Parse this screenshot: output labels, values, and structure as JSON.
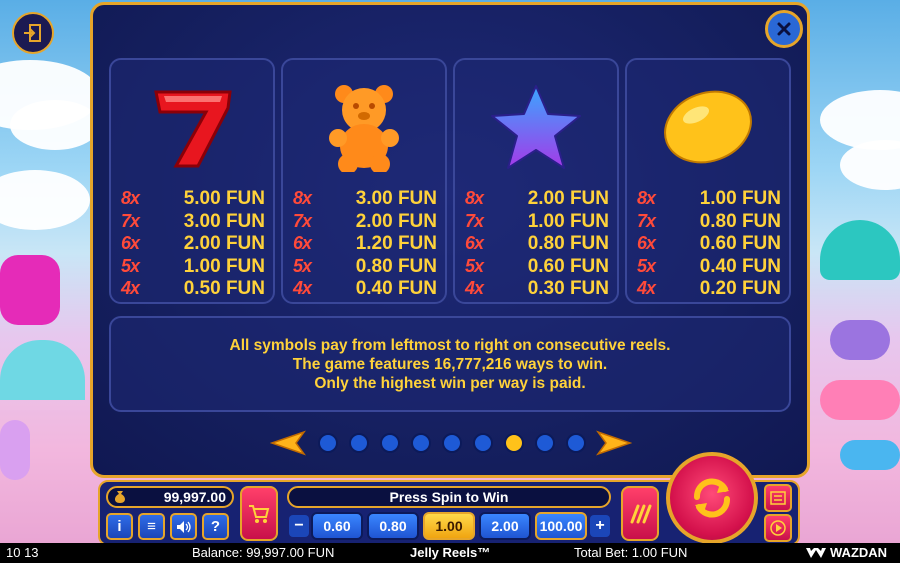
{
  "colors": {
    "panel_border": "#e6a52a",
    "payout_text": "#ffd23a",
    "count_text": "#ff4a3a",
    "panel_bg": "#141e5c"
  },
  "top": {
    "exit_icon": "exit-door-icon",
    "close_icon": "close-x-icon"
  },
  "paytable": [
    {
      "symbol": "red-seven-icon",
      "rows": [
        {
          "count": "8x",
          "amount": "5.00 FUN"
        },
        {
          "count": "7x",
          "amount": "3.00 FUN"
        },
        {
          "count": "6x",
          "amount": "2.00 FUN"
        },
        {
          "count": "5x",
          "amount": "1.00 FUN"
        },
        {
          "count": "4x",
          "amount": "0.50 FUN"
        }
      ]
    },
    {
      "symbol": "orange-bear-icon",
      "rows": [
        {
          "count": "8x",
          "amount": "3.00 FUN"
        },
        {
          "count": "7x",
          "amount": "2.00 FUN"
        },
        {
          "count": "6x",
          "amount": "1.20 FUN"
        },
        {
          "count": "5x",
          "amount": "0.80 FUN"
        },
        {
          "count": "4x",
          "amount": "0.40 FUN"
        }
      ]
    },
    {
      "symbol": "blue-star-icon",
      "rows": [
        {
          "count": "8x",
          "amount": "2.00 FUN"
        },
        {
          "count": "7x",
          "amount": "1.00 FUN"
        },
        {
          "count": "6x",
          "amount": "0.80 FUN"
        },
        {
          "count": "5x",
          "amount": "0.60 FUN"
        },
        {
          "count": "4x",
          "amount": "0.30 FUN"
        }
      ]
    },
    {
      "symbol": "yellow-lemon-icon",
      "rows": [
        {
          "count": "8x",
          "amount": "1.00 FUN"
        },
        {
          "count": "7x",
          "amount": "0.80 FUN"
        },
        {
          "count": "6x",
          "amount": "0.60 FUN"
        },
        {
          "count": "5x",
          "amount": "0.40 FUN"
        },
        {
          "count": "4x",
          "amount": "0.20 FUN"
        }
      ]
    }
  ],
  "info": {
    "line1": "All symbols pay from leftmost to right on consecutive reels.",
    "line2": "The game features 16,777,216 ways to win.",
    "line3": "Only the highest win per way is paid."
  },
  "pager": {
    "total_pages": 9,
    "active_page": 7
  },
  "controls": {
    "balance": "99,997.00",
    "status": "Press Spin to Win",
    "info_btn": "i",
    "menu_btn": "≡",
    "help_btn": "?",
    "minus": "−",
    "plus": "+",
    "bets": [
      "0.60",
      "0.80",
      "1.00",
      "2.00",
      "100.00"
    ],
    "selected_bet": "1.00"
  },
  "status_bar": {
    "time": "10 13",
    "balance": "Balance: 99,997.00 FUN",
    "game": "Jelly Reels™",
    "total_bet": "Total Bet: 1.00 FUN",
    "brand": "WAZDAN"
  }
}
